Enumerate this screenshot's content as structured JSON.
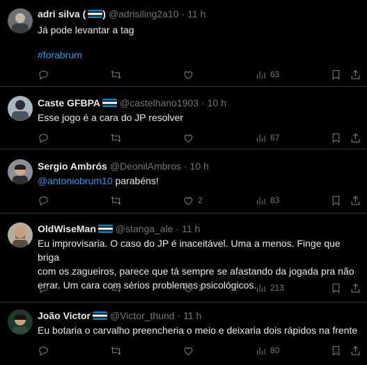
{
  "tweets": [
    {
      "name": "adri silva (",
      "name_suffix": ")",
      "handle": "@adrisiling2a10",
      "time": "11 h",
      "text_lines": [
        "Já pode levantar a tag"
      ],
      "hashtag": "#forabrum",
      "likes": "",
      "views": "63"
    },
    {
      "name": "Caste GFBPA",
      "handle": "@castelhano1903",
      "time": "10 h",
      "text_lines": [
        "Esse jogo é a cara do JP resolver"
      ],
      "likes": "",
      "views": "67"
    },
    {
      "name": "Sergio Ambrós",
      "handle": "@DeonilAmbros",
      "time": "10 h",
      "mention": "@antoniobrum10",
      "text_after_mention": " parabéns!",
      "likes": "2",
      "views": "83"
    },
    {
      "name": "OldWiseMan",
      "handle": "@stanga_ale",
      "time": "11 h",
      "text_lines": [
        "Eu improvisaria. O caso do JP é inaceitável. Uma a menos. Finge que briga",
        "com os zagueiros, parece que tá sempre se afastando da jogada pra não",
        "errar. Um cara com sérios problemas psicológicos."
      ],
      "likes": "1",
      "views": "213"
    },
    {
      "name": "João Victor",
      "handle": "@Victor_thund",
      "time": "11 h",
      "text_lines": [
        "Eu botaria o carvalho preencheria o meio e deixaria dois rápidos na frente"
      ],
      "likes": "",
      "views": "80"
    }
  ],
  "colors": {
    "background": "#000000",
    "text": "#e7e9ea",
    "muted": "#71767b",
    "link": "#1d9bf0",
    "divider": "#2f3336"
  },
  "icons": [
    "reply-icon",
    "retweet-icon",
    "like-icon",
    "views-icon",
    "bookmark-icon",
    "share-icon",
    "grêmio-flag-icon"
  ]
}
